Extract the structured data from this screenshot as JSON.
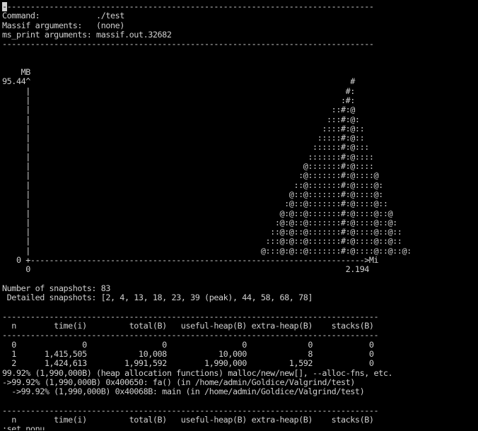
{
  "terminal": {
    "fg_color": "#d0d0d0",
    "bg_color": "#000000",
    "cursor_char": "-",
    "lines": [
      "-------------------------------------------------------------------------------",
      "Command:            ./test",
      "Massif arguments:   (none)",
      "ms_print arguments: massif.out.32682",
      "-------------------------------------------------------------------------------",
      "",
      "",
      "    MB",
      "95.44^                                                                    #",
      "     |                                                                   #:",
      "     |                                                                  :#:",
      "     |                                                                ::#:@",
      "     |                                                               :::#:@:",
      "     |                                                              ::::#:@::",
      "     |                                                             :::::#:@::",
      "     |                                                            ::::::#:@:::",
      "     |                                                           :::::::#:@::::",
      "     |                                                          @:::::::#:@::::",
      "     |                                                         :@:::::::#:@::::@",
      "     |                                                        ::@:::::::#:@::::@:",
      "     |                                                       @::@:::::::#:@::::@:",
      "     |                                                      :@::@:::::::#:@::::@::",
      "     |                                                     @:@::@:::::::#:@::::@::@",
      "     |                                                    :@:@::@:::::::#:@::::@::@:",
      "     |                                                   ::@:@::@:::::::#:@::::@::@::",
      "     |                                                  :::@:@::@:::::::#:@::::@::@::",
      "     |                                                 @:::@:@::@:::::::#:@::::@::@::@:",
      "   0 +----------------------------------------------------------------------->Mi",
      "     0                                                                   2.194",
      "",
      "Number of snapshots: 83",
      " Detailed snapshots: [2, 4, 13, 18, 23, 39 (peak), 44, 58, 68, 78]",
      "",
      "--------------------------------------------------------------------------------",
      "  n        time(i)         total(B)   useful-heap(B) extra-heap(B)    stacks(B)",
      "--------------------------------------------------------------------------------",
      "  0              0                0                0             0            0",
      "  1      1,415,505           10,008           10,000             8            0",
      "  2      1,424,613        1,991,592        1,990,000         1,592            0",
      "99.92% (1,990,000B) (heap allocation functions) malloc/new/new[], --alloc-fns, etc.",
      "->99.92% (1,990,000B) 0x400650: fa() (in /home/admin/Goldice/Valgrind/test)",
      "  ->99.92% (1,990,000B) 0x40068B: main (in /home/admin/Goldice/Valgrind/test)",
      "",
      "--------------------------------------------------------------------------------",
      "  n        time(i)         total(B)   useful-heap(B) extra-heap(B)    stacks(B)",
      ":set nonu"
    ]
  }
}
